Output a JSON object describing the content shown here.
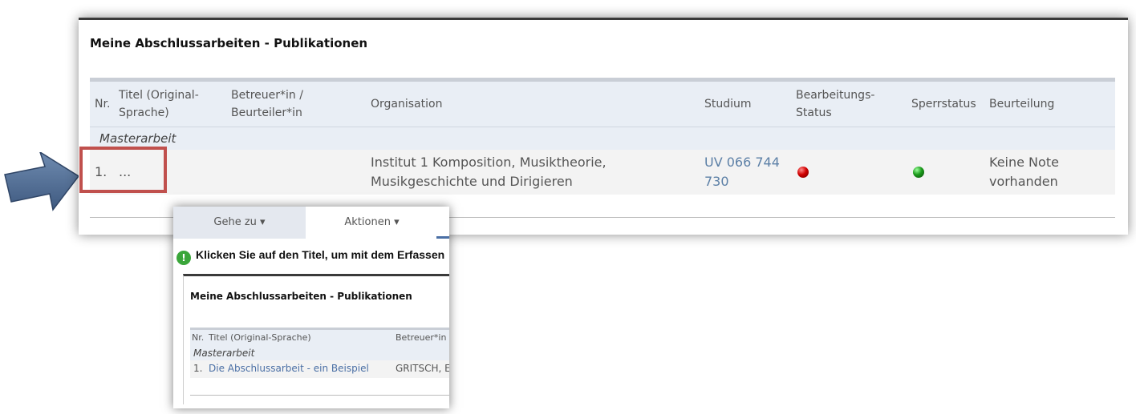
{
  "main": {
    "title": "Meine Abschlussarbeiten - Publikationen",
    "columns": {
      "nr": "Nr.",
      "titel_1": "Titel (Original-",
      "titel_2": "Sprache)",
      "betreuer_1": "Betreuer*in /",
      "betreuer_2": "Beurteiler*in",
      "organisation": "Organisation",
      "studium": "Studium",
      "status_1": "Bearbeitungs-",
      "status_2": "Status",
      "sperrstatus": "Sperrstatus",
      "beurteilung": "Beurteilung"
    },
    "group": "Masterarbeit",
    "row": {
      "nr": "1.",
      "titel": "...",
      "org_1": "Institut 1 Komposition, Musiktheorie,",
      "org_2": "Musikgeschichte und Dirigieren",
      "studium_1": "UV 066 744",
      "studium_2": "730",
      "bearbeitungsstatus_icon": "red-status-dot",
      "sperrstatus_icon": "green-status-dot",
      "beurteilung_1": "Keine Note",
      "beurteilung_2": "vorhanden"
    }
  },
  "inset": {
    "tabs": [
      "Gehe zu ▾",
      "Aktionen ▾"
    ],
    "notice": "Klicken Sie auf den Titel, um mit dem Erfassen",
    "title": "Meine Abschlussarbeiten - Publikationen",
    "columns": {
      "nr": "Nr.",
      "titel": "Titel (Original-Sprache)",
      "betreuer": "Betreuer*in"
    },
    "group": "Masterarbeit",
    "row": {
      "nr": "1.",
      "titel": "Die Abschlussarbeit - ein Beispiel",
      "betreuer": "GRITSCH, E"
    }
  },
  "colors": {
    "highlight": "#c0504d",
    "arrow": "#4f6a90",
    "link": "#5b7fa6",
    "header_bg": "#e9eef5"
  },
  "icons": [
    "arrow-right-icon",
    "info-bubble-icon",
    "red-status-dot",
    "green-status-dot",
    "caret-down-icon"
  ]
}
